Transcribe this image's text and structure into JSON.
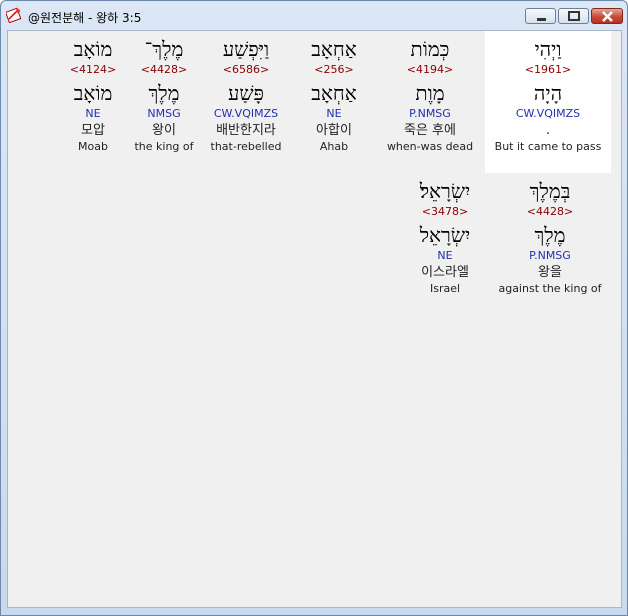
{
  "window": {
    "title": "@원전분해 - 왕하 3:5"
  },
  "rows": [
    [
      {
        "heb": "וַיְהִי",
        "strong": "<1961>",
        "root": "הָיָה",
        "morph": "CW.VQIMZS",
        "kor": ".",
        "eng": "But it came to pass",
        "selected": true
      },
      {
        "heb": "כְּמוֹת",
        "strong": "<4194>",
        "root": "מָוֶת",
        "morph": "P.NMSG",
        "kor": "죽은 후에",
        "eng": "when-was dead"
      },
      {
        "heb": "אַחְאָב",
        "strong": "<256>",
        "root": "אַחְאָב",
        "morph": "NE",
        "kor": "아합이",
        "eng": "Ahab"
      },
      {
        "heb": "וַיִּפְשַׁע",
        "strong": "<6586>",
        "root": "פָּשַׁע",
        "morph": "CW.VQIMZS",
        "kor": "배반한지라",
        "eng": "that-rebelled"
      },
      {
        "heb": "מֶלֶךְ־",
        "strong": "<4428>",
        "root": "מֶלֶךְ",
        "morph": "NMSG",
        "kor": "왕이",
        "eng": "the king of"
      },
      {
        "heb": "מוֹאָב",
        "strong": "<4124>",
        "root": "מוֹאָב",
        "morph": "NE",
        "kor": "모압",
        "eng": "Moab"
      }
    ],
    [
      {
        "heb": "בְּמֶלֶךְ",
        "strong": "<4428>",
        "root": "מֶלֶךְ",
        "morph": "P.NMSG",
        "kor": "왕을",
        "eng": "against the king of"
      },
      {
        "heb": "יִשְׂרָאֵל׃",
        "strong": "<3478>",
        "root": "יִשְׂרָאֵל",
        "morph": "NE",
        "kor": "이스라엘",
        "eng": "Israel"
      }
    ]
  ]
}
